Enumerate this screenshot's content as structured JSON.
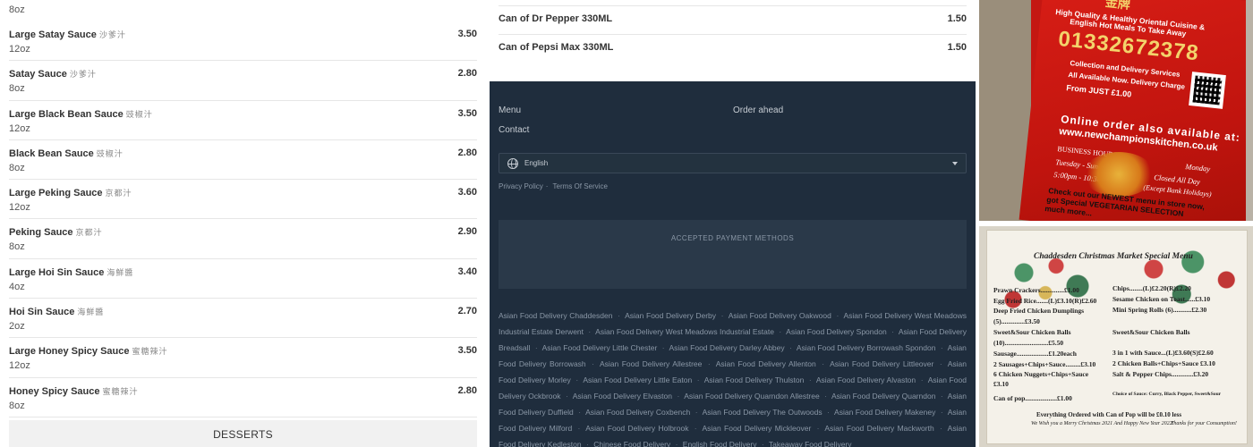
{
  "left_menu": {
    "first_desc": "8oz",
    "items": [
      {
        "name": "Large Satay Sauce",
        "cjk": "沙爹汁",
        "price": "3.50",
        "desc": "12oz"
      },
      {
        "name": "Satay Sauce",
        "cjk": "沙爹汁",
        "price": "2.80",
        "desc": "8oz"
      },
      {
        "name": "Large Black Bean Sauce",
        "cjk": "豉椒汁",
        "price": "3.50",
        "desc": "12oz"
      },
      {
        "name": "Black Bean Sauce",
        "cjk": "豉椒汁",
        "price": "2.80",
        "desc": "8oz"
      },
      {
        "name": "Large Peking Sauce",
        "cjk": "京都汁",
        "price": "3.60",
        "desc": "12oz"
      },
      {
        "name": "Peking Sauce",
        "cjk": "京都汁",
        "price": "2.90",
        "desc": "8oz"
      },
      {
        "name": "Large Hoi Sin Sauce",
        "cjk": "海鮮醬",
        "price": "3.40",
        "desc": "4oz"
      },
      {
        "name": "Hoi Sin Sauce",
        "cjk": "海鮮醬",
        "price": "2.70",
        "desc": "2oz"
      },
      {
        "name": "Large Honey Spicy Sauce",
        "cjk": "蜜糖辣汁",
        "price": "3.50",
        "desc": "12oz"
      },
      {
        "name": "Honey Spicy Sauce",
        "cjk": "蜜糖辣汁",
        "price": "2.80",
        "desc": "8oz"
      }
    ],
    "section_title": "DESSERTS"
  },
  "drinks": [
    {
      "name": "Can of Dr Pepper 330ML",
      "price": "1.50"
    },
    {
      "name": "Can of Pepsi Max 330ML",
      "price": "1.50"
    }
  ],
  "footer": {
    "links": {
      "menu": "Menu",
      "order_ahead": "Order ahead",
      "contact": "Contact"
    },
    "language": "English",
    "privacy": "Privacy Policy",
    "separator": "·",
    "terms": "Terms Of Service",
    "payment_title": "ACCEPTED PAYMENT METHODS",
    "areas": [
      "Asian Food Delivery Chaddesden",
      "Asian Food Delivery Derby",
      "Asian Food Delivery Oakwood",
      "Asian Food Delivery West Meadows Industrial Estate Derwent",
      "Asian Food Delivery West Meadows Industrial Estate",
      "Asian Food Delivery Spondon",
      "Asian Food Delivery Breadsall",
      "Asian Food Delivery Little Chester",
      "Asian Food Delivery Darley Abbey",
      "Asian Food Delivery Borrowash Spondon",
      "Asian Food Delivery Borrowash",
      "Asian Food Delivery Allestree",
      "Asian Food Delivery Allenton",
      "Asian Food Delivery Littleover",
      "Asian Food Delivery Morley",
      "Asian Food Delivery Little Eaton",
      "Asian Food Delivery Thulston",
      "Asian Food Delivery Alvaston",
      "Asian Food Delivery Ockbrook",
      "Asian Food Delivery Elvaston",
      "Asian Food Delivery Quarndon Allestree",
      "Asian Food Delivery Quarndon",
      "Asian Food Delivery Duffield",
      "Asian Food Delivery Coxbench",
      "Asian Food Delivery The Outwoods",
      "Asian Food Delivery Makeney",
      "Asian Food Delivery Milford",
      "Asian Food Delivery Holbrook",
      "Asian Food Delivery Mickleover",
      "Asian Food Delivery Mackworth",
      "Asian Food Delivery Kedleston",
      "Chinese Food Delivery",
      "English Food Delivery",
      "Takeaway Food Delivery"
    ]
  },
  "photo1": {
    "cjk_title": "金牌",
    "tagline1": "High Quality & Healthy Oriental Cuisine &",
    "tagline2": "English Hot Meals To Take Away",
    "phone": "01332672378",
    "svc1": "Collection and Delivery Services",
    "svc2": "All Available Now. Delivery Charge",
    "svc3": "From JUST £1.00",
    "online1": "Online order also available at:",
    "url": "www.newchampionskitchen.co.uk",
    "hours_label": "BUSINESS HOURS",
    "days": "Tuesday - Sunday",
    "times": "5:00pm - 10:30pm",
    "closed": "Closed All Day",
    "monday": "Monday",
    "except": "(Except Bank Holidays)",
    "check1": "Check out our NEWEST menu in store now,",
    "check2": "got Special VEGETARIAN SELECTION",
    "check3": "much more..."
  },
  "photo2": {
    "title": "Chaddesden Christmas Market Special Menu",
    "lines": [
      "Prawn Crackers..............£1.00",
      "Egg Fried Rice.......(L)£3.10(R)£2.60",
      "Deep Fried Chicken Dumplings",
      "(5)..............£3.50",
      "Sweet&Sour Chicken Balls",
      "(10)..........................£5.50",
      "Sausage...................£1.20each",
      "2 Sausages+Chips+Sauce.........£3.10",
      "6 Chicken Nuggets+Chips+Sauce",
      "£3.10",
      "Can of pop...................£1.00"
    ],
    "right_lines": [
      "Chips........(L)£2.20(R)£2.20",
      "Sesame Chicken on Toast......£3.10",
      "Mini Spring Rolls (6)...........£2.30",
      "Sweet&Sour Chicken Balls",
      "3 in 1 with Sauce...(L)£3.60(S)£2.60",
      "2 Chicken Balls+Chips+Sauce £3.10",
      "Salt & Pepper Chips.............£3.20",
      "Choice of Sauce: Curry, Black Pepper, Sweet&Sour"
    ],
    "footer": "Everything Ordered with Can of Pop will be £0.10 less",
    "footer2": "We Wish you a Merry Christmas 2021 And Happy New Year 2022!",
    "footer3": "Thanks for your Consumption!"
  }
}
